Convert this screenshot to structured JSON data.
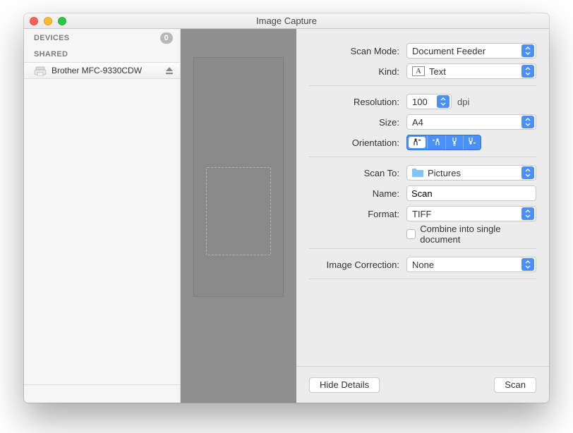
{
  "window": {
    "title": "Image Capture"
  },
  "sidebar": {
    "devices_label": "DEVICES",
    "devices_count": "0",
    "shared_label": "SHARED",
    "device_name": "Brother MFC-9330CDW"
  },
  "panel": {
    "scan_mode": {
      "label": "Scan Mode:",
      "value": "Document Feeder"
    },
    "kind": {
      "label": "Kind:",
      "value": "Text"
    },
    "resolution": {
      "label": "Resolution:",
      "value": "100",
      "unit": "dpi"
    },
    "size": {
      "label": "Size:",
      "value": "A4"
    },
    "orientation": {
      "label": "Orientation:"
    },
    "scan_to": {
      "label": "Scan To:",
      "value": "Pictures"
    },
    "name": {
      "label": "Name:",
      "value": "Scan"
    },
    "format": {
      "label": "Format:",
      "value": "TIFF"
    },
    "combine": {
      "label": "Combine into single document"
    },
    "image_correction": {
      "label": "Image Correction:",
      "value": "None"
    }
  },
  "footer": {
    "hide_details": "Hide Details",
    "scan": "Scan"
  }
}
